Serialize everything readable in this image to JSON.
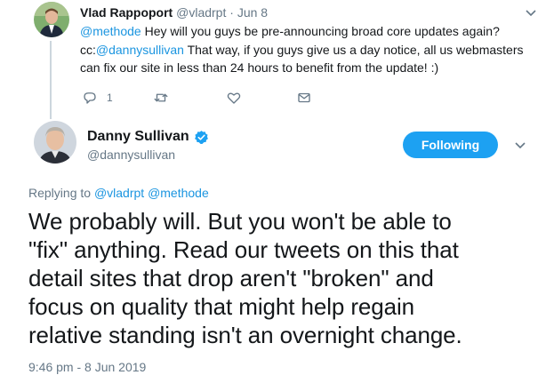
{
  "parent_tweet": {
    "author_name": "Vlad Rappoport",
    "author_handle": "@vladrpt",
    "dot": "·",
    "time": "Jun 8",
    "text_line1_mention": "@methode",
    "text_line1_rest": " Hey will you guys be pre-announcing broad core updates again?",
    "text_line2_prefix": "cc:",
    "text_line2_mention": "@dannysullivan",
    "text_line2_rest": " That way, if you guys give us a day notice, all us webmasters",
    "text_line3": "can fix our site in less than 24 hours to benefit from the update! :)",
    "reply_count": "1",
    "icons": [
      "reply-icon",
      "retweet-icon",
      "like-icon",
      "direct-message-icon",
      "chevron-down-icon"
    ]
  },
  "main_tweet": {
    "author_name": "Danny Sullivan",
    "author_handle": "@dannysullivan",
    "follow_label": "Following",
    "replying_prefix": "Replying to ",
    "replying_to_1": "@vladrpt",
    "replying_to_2": "@methode",
    "text_lines": [
      "We probably will. But you won't be able to",
      "\"fix\" anything. Read our tweets on this that",
      "detail sites that drop aren't \"broken\" and",
      "focus on quality that might help regain",
      "relative standing isn't an overnight change."
    ],
    "timestamp": "9:46 pm - 8 Jun 2019"
  },
  "colors": {
    "link": "#1b95e0",
    "accent": "#1da1f2",
    "secondary_text": "#657786",
    "thread_line": "#ccd6dd"
  }
}
